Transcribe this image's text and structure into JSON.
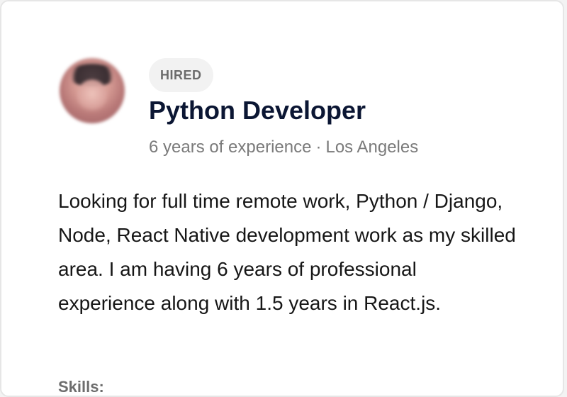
{
  "profile": {
    "status_badge": "HIRED",
    "title": "Python Developer",
    "experience": "6 years of experience",
    "separator": "·",
    "location": "Los Angeles",
    "description": "Looking for full time remote work, Python / Django, Node, React Native development work as my skilled area. I am having 6 years of professional experience along with 1.5 years in React.js.",
    "skills_label": "Skills:"
  },
  "theme": {
    "title_color": "#0b1633",
    "meta_color": "#7a7a7a",
    "badge_bg": "#f2f2f2",
    "badge_text": "#6b6b6b"
  }
}
